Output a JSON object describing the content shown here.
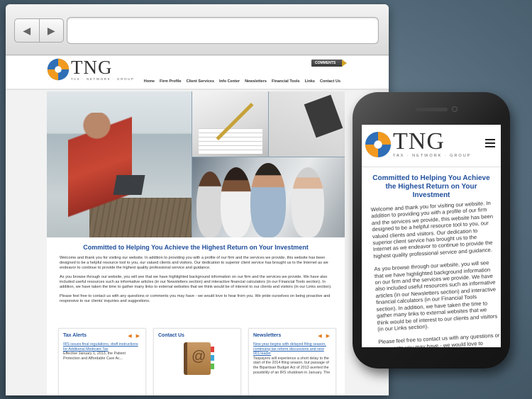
{
  "site": {
    "logo_word": "TNG",
    "logo_tagline": "TAX · NETWORK · GROUP"
  },
  "header": {
    "comments_label": "COMMENTS",
    "nav": [
      "Home",
      "Firm Profile",
      "Client Services",
      "Info Center",
      "Newsletters",
      "Financial Tools",
      "Links",
      "Contact Us"
    ]
  },
  "main": {
    "tagline": "Committed to Helping You Achieve the Highest Return on Your Investment",
    "paragraphs": [
      "Welcome and thank you for visiting our website. In addition to providing you with a profile of our firm and the services we provide, this website has been designed to be a helpful resource tool to you, our valued clients and visitors. Our dedication to superior client service has brought us to the Internet as we endeavor to continue to provide the highest quality professional service and guidance.",
      "As you browse through our website, you will see that we have highlighted background information on our firm and the services we provide. We have also included useful resources such as informative articles (in our Newsletters section) and interactive financial calculators (in our Financial Tools section). In addition, we have taken the time to gather many links to external websites that we think would be of interest to our clients and visitors (in our Links section).",
      "Please feel free to contact us with any questions or comments you may have - we would love to hear from you. We pride ourselves on being proactive and responsive to our clients' inquiries and suggestions."
    ]
  },
  "boxes": {
    "tax_alerts": {
      "title": "Tax Alerts",
      "link": "IRS issues final regulations, draft instructions for Additional Medicare Tax",
      "text": "Effective January 1, 2013, the Patient Protection and Affordable Care Ac..."
    },
    "contact": {
      "title": "Contact Us"
    },
    "newsletters": {
      "title": "Newsletters",
      "link": "New year begins with delayed filing season, continuing tax reform discussions and new IRS leader",
      "text": "Taxpayers will experience a short delay to the start of the 2014 filing season, but passage of the Bipartisan Budget Act of 2013 averted the possibility of an IRS shutdown in January. The"
    },
    "arrows": "◀ ▶"
  },
  "mobile": {
    "tagline": "Committed to Helping You Achieve the Highest Return on Your Investment",
    "paragraphs": [
      "Welcome and thank you for visiting our website. In addition to providing you with a profile of our firm and the services we provide, this website has been designed to be a helpful resource tool to you, our valued clients and visitors. Our dedication to superior client service has brought us to the Internet as we endeavor to continue to provide the highest quality professional service and guidance.",
      "As you browse through our website, you will see that we have highlighted background information on our firm and the services we provide. We have also included useful resources such as informative articles (in our Newsletters section) and interactive financial calculators (in our Financial Tools section). In addition, we have taken the time to gather many links to external websites that we think would be of interest to our clients and visitors (in our Links section).",
      "Please feel free to contact us with any questions or comments you may have - we would love to"
    ]
  },
  "colors": {
    "brand_blue": "#1f4f9c",
    "accent_orange": "#e07b1c",
    "link_blue": "#2a66b4"
  }
}
